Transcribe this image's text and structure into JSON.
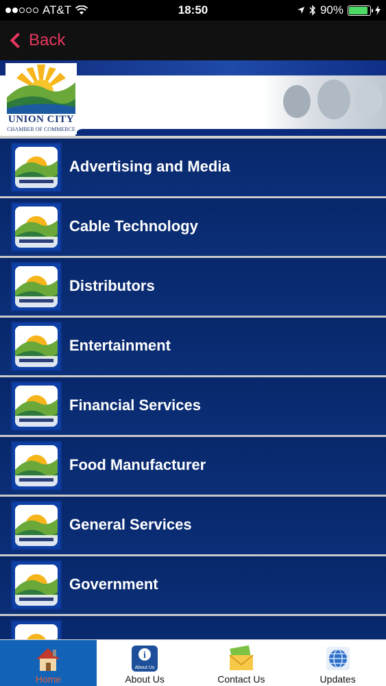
{
  "status": {
    "carrier": "AT&T",
    "time": "18:50",
    "battery": "90%",
    "battery_level": 0.9
  },
  "nav": {
    "back_label": "Back"
  },
  "banner": {
    "logo_title": "UNION CITY",
    "logo_subtitle": "CHAMBER OF COMMERCE"
  },
  "list": {
    "items": [
      {
        "label": "Advertising and Media"
      },
      {
        "label": "Cable Technology"
      },
      {
        "label": "Distributors"
      },
      {
        "label": "Entertainment"
      },
      {
        "label": "Financial Services"
      },
      {
        "label": "Food Manufacturer"
      },
      {
        "label": "General Services"
      },
      {
        "label": "Government"
      },
      {
        "label": ""
      }
    ]
  },
  "tabs": [
    {
      "label": "Home"
    },
    {
      "label": "About Us",
      "icon_text": "About Us"
    },
    {
      "label": "Contact Us"
    },
    {
      "label": "Updates"
    }
  ],
  "colors": {
    "accent": "#e8375e",
    "list_bg": "#0a2d74",
    "active_tab": "#1263b8"
  }
}
